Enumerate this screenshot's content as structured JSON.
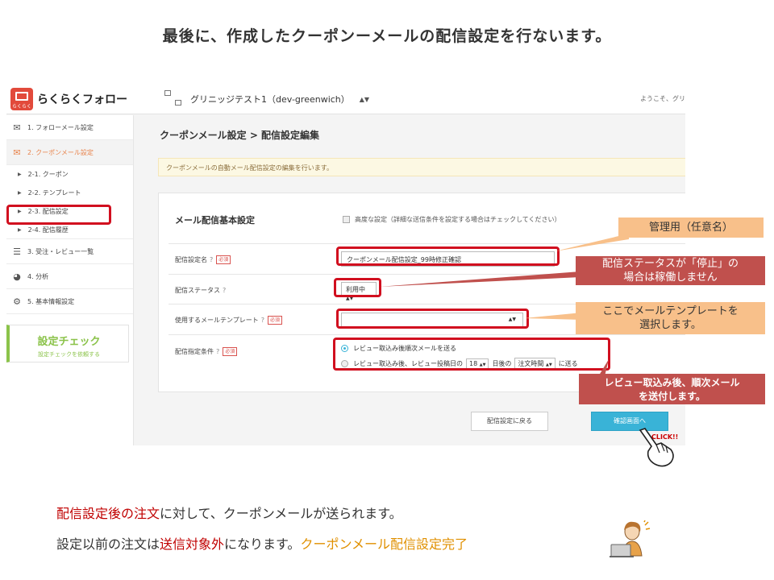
{
  "slide": {
    "title": "最後に、作成したクーポンーメールの配信設定を行ないます。",
    "footer_line1_red": "配信設定後の注文",
    "footer_line1_rest": "に対して、クーポンメールが送られます。",
    "footer_line2_a": "設定以前の注文は",
    "footer_line2_red": "送信対象外",
    "footer_line2_b": "になります。",
    "footer_line2_gold": "クーポンメール配信設定完了"
  },
  "app": {
    "logo_text": "らくらくフォロー",
    "logo_mark_text": "らくらく",
    "store_name": "グリニッジテスト1（dev-greenwich）",
    "welcome": "ようこそ、グリ"
  },
  "sidebar": {
    "items": [
      {
        "label": "1. フォローメール設定",
        "icon": "mail-icon",
        "glyph": "✉"
      },
      {
        "label": "2. クーポンメール設定",
        "icon": "coupon-mail-icon",
        "glyph": "✉"
      },
      {
        "label": "3. 受注・レビュー一覧",
        "icon": "list-icon",
        "glyph": "☰"
      },
      {
        "label": "4. 分析",
        "icon": "pie-chart-icon",
        "glyph": "◕"
      },
      {
        "label": "5. 基本情報設定",
        "icon": "gear-icon",
        "glyph": "⚙"
      }
    ],
    "sub_items": [
      {
        "label": "2-1. クーポン"
      },
      {
        "label": "2-2. テンプレート"
      },
      {
        "label": "2-3. 配信設定"
      },
      {
        "label": "2-4. 配信履歴"
      }
    ],
    "check": {
      "title": "設定チェック",
      "subtitle": "設定チェックを依頼する"
    }
  },
  "main": {
    "breadcrumb": "クーポンメール設定 > 配信設定編集",
    "notice": "クーポンメールの自動メール配信設定の編集を行います。",
    "card_title": "メール配信基本設定",
    "advanced_label": "高度な設定（詳細な送信条件を設定する場合はチェックしてください）",
    "required": "必須",
    "fields": {
      "name_label": "配信設定名",
      "name_value": "クーポンメール配信設定_99時修正確認",
      "status_label": "配信ステータス",
      "status_value": "利用中",
      "template_label": "使用するメールテンプレート",
      "template_value": "",
      "condition_label": "配信指定条件",
      "radio1": "レビュー取込み後順次メールを送る",
      "radio2_a": "レビュー取込み後、レビュー投稿日の",
      "radio2_days": "18",
      "radio2_b": "日後の",
      "radio2_sel": "注文時間",
      "radio2_c": "に送る"
    },
    "btn_back": "配信設定に戻る",
    "btn_confirm": "確認画面へ"
  },
  "callouts": {
    "c1": "管理用（任意名）",
    "c2a": "配信ステータスが「停止」の",
    "c2b": "場合は稼働しません",
    "c3a": "ここでメールテンプレートを",
    "c3b": "選択します。",
    "c4a": "レビュー取込み後、順次メール",
    "c4b": "を送付します。",
    "click": "CLICK!!"
  },
  "colors": {
    "accent": "#39b3d7",
    "highlight": "#d10f1f",
    "callout_orange": "#f8c08a",
    "callout_red": "#c0504d",
    "active_menu": "#e8824a",
    "check_green": "#8bc34a"
  }
}
